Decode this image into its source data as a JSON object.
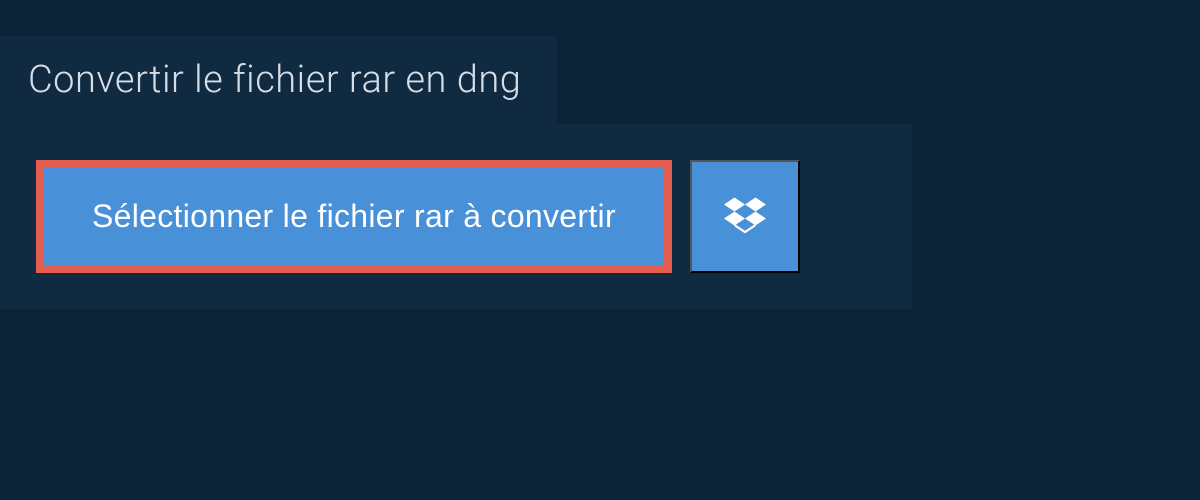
{
  "header": {
    "title": "Convertir le fichier rar en dng"
  },
  "actions": {
    "select_file_label": "Sélectionner le fichier rar à convertir"
  },
  "colors": {
    "background": "#0d2438",
    "panel": "#102a42",
    "button": "#4890d8",
    "highlight_border": "#e35d4f",
    "text_light": "#d6dde4",
    "text_white": "#ffffff"
  }
}
